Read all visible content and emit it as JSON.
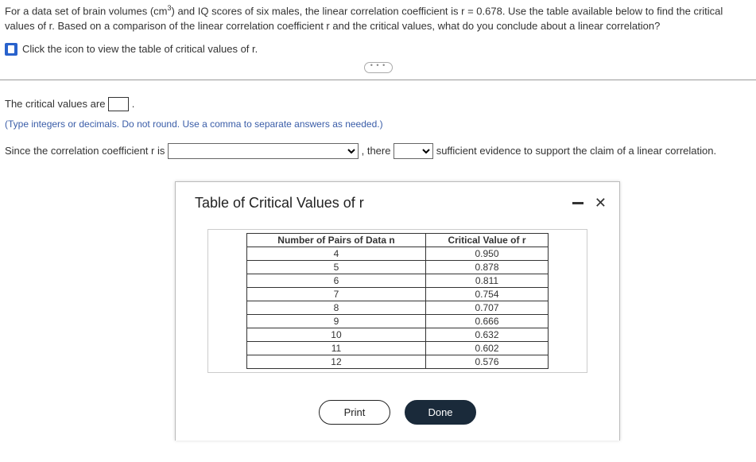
{
  "question": {
    "text_before_sup": "For a data set of brain volumes (cm",
    "sup": "3",
    "text_after_sup": ") and IQ scores of six males, the linear correlation coefficient is r = 0.678. Use the table available below to find the critical values of r. Based on a comparison of the linear correlation coefficient r and the critical values, what do you conclude about a linear correlation?"
  },
  "icon_link": "Click the icon to view the table of critical values of r.",
  "answers": {
    "crit_values_before": "The critical values are ",
    "crit_values_after": ".",
    "hint": "(Type integers or decimals. Do not round. Use a comma to separate answers as needed.)",
    "since_before": "Since the correlation coefficient r is ",
    "there": ", there ",
    "tail": " sufficient evidence to support the claim of a linear correlation."
  },
  "modal": {
    "title": "Table of Critical Values of r",
    "header_n": "Number of Pairs of Data n",
    "header_r": "Critical Value of r",
    "rows": [
      {
        "n": "4",
        "r": "0.950"
      },
      {
        "n": "5",
        "r": "0.878"
      },
      {
        "n": "6",
        "r": "0.811"
      },
      {
        "n": "7",
        "r": "0.754"
      },
      {
        "n": "8",
        "r": "0.707"
      },
      {
        "n": "9",
        "r": "0.666"
      },
      {
        "n": "10",
        "r": "0.632"
      },
      {
        "n": "11",
        "r": "0.602"
      },
      {
        "n": "12",
        "r": "0.576"
      }
    ],
    "print": "Print",
    "done": "Done"
  }
}
